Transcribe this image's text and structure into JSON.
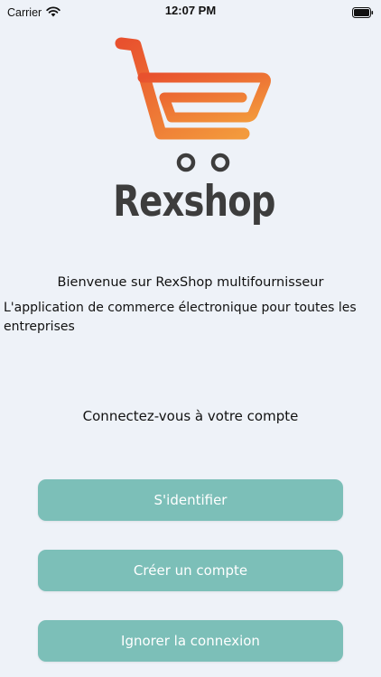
{
  "status_bar": {
    "carrier": "Carrier",
    "time": "12:07 PM"
  },
  "brand": {
    "name": "Rexshop",
    "gradient_start": "#f39a3c",
    "gradient_end": "#e8512e",
    "wheel_color": "#3d3d3d"
  },
  "welcome": {
    "title": "Bienvenue sur RexShop multifournisseur",
    "subtitle": "L'application de commerce électronique pour toutes les entreprises"
  },
  "auth": {
    "heading": "Connectez-vous à votre compte",
    "login_label": "S'identifier",
    "register_label": "Créer un compte",
    "skip_label": "Ignorer la connexion",
    "button_color": "#7cbfb8"
  }
}
